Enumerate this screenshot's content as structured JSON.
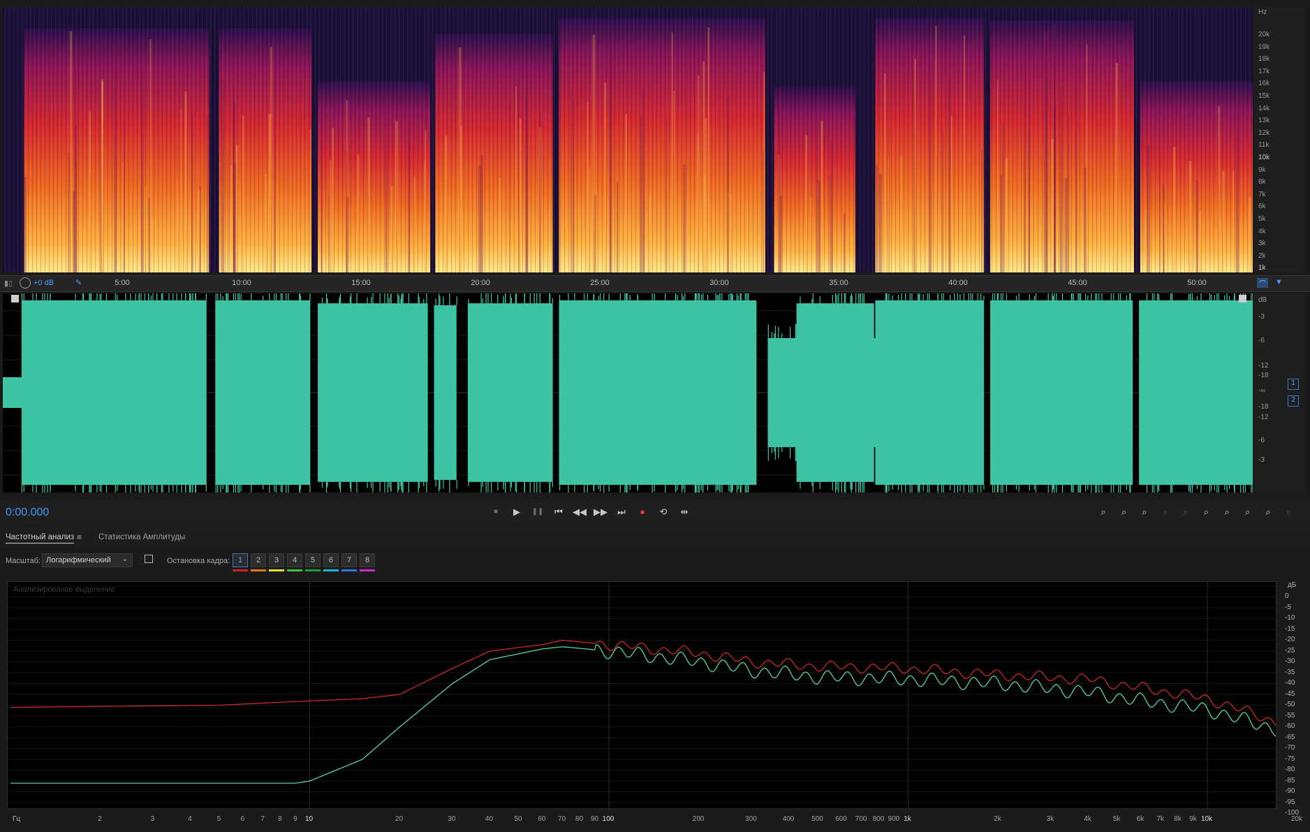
{
  "spectrogram": {
    "unit_label": "Hz",
    "freq_labels": [
      "20k",
      "19k",
      "18k",
      "17k",
      "16k",
      "15k",
      "14k",
      "13k",
      "12k",
      "11k",
      "10k",
      "9k",
      "8k",
      "7k",
      "6k",
      "5k",
      "4k",
      "3k",
      "2k",
      "1k"
    ]
  },
  "ruler": {
    "gain_label": "+0 dB",
    "time_ticks": [
      "5:00",
      "10:00",
      "15:00",
      "20:00",
      "25:00",
      "30:00",
      "35:00",
      "40:00",
      "45:00",
      "50:00"
    ]
  },
  "waveform": {
    "unit_label": "dB",
    "db_labels": [
      "-3",
      "-6",
      "-12",
      "-18",
      "-∞",
      "-18",
      "-12",
      "-6",
      "-3"
    ],
    "channel_1": "1",
    "channel_2": "2",
    "colors": {
      "wave": "#3ec4a4",
      "background": "#000000"
    }
  },
  "transport": {
    "time": "0:00.000",
    "buttons": [
      "stop-icon",
      "play-icon",
      "pause-icon",
      "skip-to-start-icon",
      "rewind-icon",
      "fast-forward-icon",
      "skip-to-end-icon",
      "record-icon",
      "loop-icon",
      "skip-selection-icon"
    ],
    "zoom_buttons": [
      "zoom-in-amplitude-icon",
      "zoom-out-amplitude-icon",
      "zoom-in-time-icon",
      "zoom-out-time-icon",
      "zoom-full-icon",
      "zoom-in-left-icon",
      "zoom-in-right-icon",
      "zoom-selection-icon",
      "zoom-tracks-icon",
      "zoom-reset-icon"
    ]
  },
  "tabs": {
    "frequency_analysis": "Частотный анализ",
    "amplitude_stats": "Статистика Амплитуды"
  },
  "controls": {
    "scale_label": "Масштаб:",
    "scale_value": "Логарифмический",
    "freeze_label": "Остановка кадра:",
    "freeze_buttons": [
      "1",
      "2",
      "3",
      "4",
      "5",
      "6",
      "7",
      "8"
    ],
    "freeze_colors": [
      "#d02020",
      "#e07a1a",
      "#e6e020",
      "#3bc23b",
      "#20a040",
      "#18b8d8",
      "#2f7ae0",
      "#d22ad2"
    ]
  },
  "spectrum": {
    "watermark": "Анализированое выделение",
    "db_unit": "дБ",
    "db_labels": [
      "0",
      "-5",
      "-10",
      "-15",
      "-20",
      "-25",
      "-30",
      "-35",
      "-40",
      "-45",
      "-50",
      "-55",
      "-60",
      "-65",
      "-70",
      "-75",
      "-80",
      "-85",
      "-90",
      "-95",
      "-100"
    ],
    "freq_unit": "Гц",
    "freq_labels": [
      "2",
      "3",
      "4",
      "5",
      "6",
      "7",
      "8",
      "9",
      "10",
      "20",
      "30",
      "40",
      "50",
      "60",
      "70",
      "80",
      "90",
      "100",
      "200",
      "300",
      "400",
      "500",
      "600",
      "700",
      "800",
      "900",
      "1k",
      "2k",
      "3k",
      "4k",
      "5k",
      "6k",
      "7k",
      "8k",
      "9k",
      "10k",
      "20k"
    ]
  },
  "chart_data": {
    "type": "line",
    "xlabel": "Гц",
    "ylabel": "дБ",
    "xscale": "log",
    "xlim": [
      1,
      22000
    ],
    "ylim": [
      -100,
      0
    ],
    "series": [
      {
        "color": "#c8282e",
        "x": [
          1,
          5,
          10,
          15,
          20,
          30,
          40,
          60,
          70,
          100,
          200,
          300,
          500,
          1000,
          2000,
          4000,
          6000,
          10000,
          15000,
          20000,
          21000
        ],
        "y": [
          -56,
          -55,
          -53,
          -52,
          -50,
          -38,
          -30,
          -27,
          -25,
          -27,
          -31,
          -35,
          -37,
          -38,
          -41,
          -43,
          -47,
          -52,
          -60,
          -67,
          -98
        ]
      },
      {
        "color": "#58d4a0",
        "x": [
          1,
          5,
          9,
          10,
          15,
          20,
          30,
          40,
          60,
          70,
          100,
          200,
          300,
          500,
          1000,
          2000,
          4000,
          6000,
          10000,
          15000,
          20000,
          21000
        ],
        "y": [
          -91,
          -91,
          -91,
          -90,
          -80,
          -65,
          -45,
          -34,
          -29,
          -28,
          -30,
          -35,
          -39,
          -42,
          -43,
          -45,
          -49,
          -53,
          -57,
          -64,
          -69,
          -100
        ]
      }
    ]
  }
}
